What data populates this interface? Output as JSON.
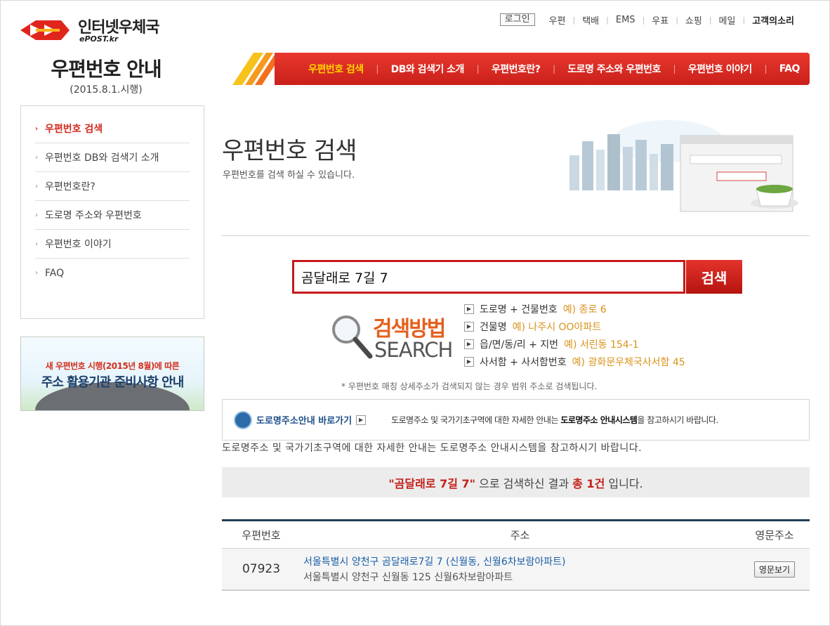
{
  "logo": {
    "ko": "인터넷우체국",
    "en": "ePOST.kr"
  },
  "site": {
    "title": "우편번호 안내",
    "subtitle": "(2015.8.1.시행)"
  },
  "util_nav": {
    "login": "로그인",
    "links": [
      "우편",
      "택배",
      "EMS",
      "우표",
      "쇼핑",
      "메일"
    ],
    "voice": "고객의소리"
  },
  "gnb": [
    "우편번호 검색",
    "DB와 검색기 소개",
    "우편번호란?",
    "도로명 주소와 우편번호",
    "우편번호 이야기",
    "FAQ"
  ],
  "lnb": [
    "우편번호 검색",
    "우편번호 DB와 검색기 소개",
    "우편번호란?",
    "도로명 주소와 우편번호",
    "우편번호 이야기",
    "FAQ"
  ],
  "banner": {
    "line1": "새 우편번호 시행(2015년 8월)에 따른",
    "line2": "주소 활용기관 준비사항 안내"
  },
  "page": {
    "title": "우편번호 검색",
    "desc": "우편번호를 검색 하실 수 있습니다."
  },
  "search": {
    "value": "곰달래로 7길 7",
    "button": "검색"
  },
  "method": {
    "title": "검색방법",
    "sub": "SEARCH",
    "items": [
      {
        "label": "도로명 + 건물번호",
        "example": "예) 종로 6"
      },
      {
        "label": "건물명",
        "example": "예) 나주시 OO아파트"
      },
      {
        "label": "읍/면/동/리 + 지번",
        "example": "예) 서린동 154-1"
      },
      {
        "label": "사서함 + 사서함번호",
        "example": "예) 광화문우체국사서함 45"
      }
    ]
  },
  "note": "* 우편번호 매칭 상세주소가 검색되지 않는 경우 범위 주소로 검색됩니다.",
  "road_info": {
    "link": "도로명주소안내 바로가기",
    "msg_pre": "도로명주소 및 국가기초구역에 대한 자세한 안내는 ",
    "msg_bold": "도로명주소 안내시스템",
    "msg_post": "을 참고하시기 바랍니다.",
    "dup": "도로명주소 및 국가기초구역에 대한 자세한 안내는 도로명주소 안내시스템을 참고하시기 바랍니다."
  },
  "result": {
    "query": "\"곰달래로 7길 7\"",
    "mid": " 으로 검색하신 결과 ",
    "count": "총 1건",
    "end": " 입니다."
  },
  "table": {
    "headers": [
      "우편번호",
      "주소",
      "영문주소"
    ],
    "rows": [
      {
        "zip": "07923",
        "road": "서울특별시 양천구 곰달래로7길 7 (신월동, 신월6차보람아파트)",
        "jibun": "서울특별시 양천구 신월동 125 신월6차보람아파트",
        "button": "영문보기"
      }
    ]
  },
  "colors": {
    "brand_red": "#d42a1e",
    "active_gnb": "#ffd200",
    "method_orange": "#e5601d",
    "example": "#d9921a",
    "table_border": "#213e56"
  }
}
